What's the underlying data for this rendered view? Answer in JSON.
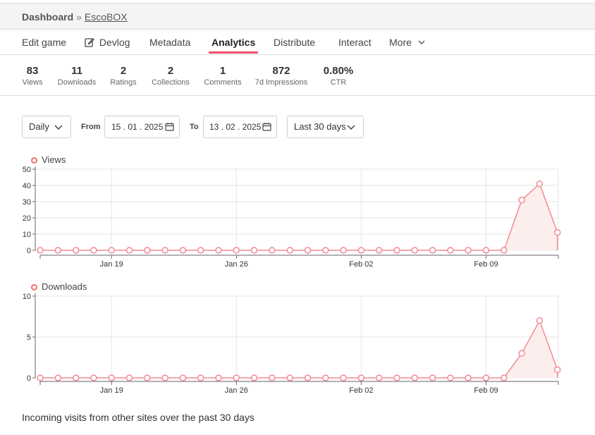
{
  "breadcrumb": {
    "root": "Dashboard",
    "separator": "»",
    "game": "EscoBOX"
  },
  "tabs": [
    {
      "label": "Edit game"
    },
    {
      "label": "Devlog"
    },
    {
      "label": "Metadata"
    },
    {
      "label": "Analytics"
    },
    {
      "label": "Distribute"
    },
    {
      "label": "Interact"
    },
    {
      "label": "More"
    }
  ],
  "active_tab": "Analytics",
  "stats": [
    {
      "value": "83",
      "label": "Views"
    },
    {
      "value": "11",
      "label": "Downloads"
    },
    {
      "value": "2",
      "label": "Ratings"
    },
    {
      "value": "2",
      "label": "Collections"
    },
    {
      "value": "1",
      "label": "Comments"
    },
    {
      "value": "872",
      "label": "7d Impressions"
    },
    {
      "value": "0.80%",
      "label": "CTR"
    }
  ],
  "controls": {
    "interval": "Daily",
    "from_label": "From",
    "from_date": "15 . 01 . 2025",
    "to_label": "To",
    "to_date": "13 . 02 . 2025",
    "range": "Last 30 days"
  },
  "colors": {
    "accent": "#f04e69",
    "series": "#f28b90",
    "fill": "#fdeeee"
  },
  "chart_data": [
    {
      "type": "area",
      "legend": "Views",
      "x_ticks": [
        "Jan 19",
        "Jan 26",
        "Feb 02",
        "Feb 09"
      ],
      "ylim": [
        0,
        50
      ],
      "y_ticks": [
        0,
        10,
        20,
        30,
        40,
        50
      ],
      "x_range": [
        "2025-01-15",
        "2025-02-13"
      ],
      "series": [
        {
          "name": "Views",
          "values": [
            0,
            0,
            0,
            0,
            0,
            0,
            0,
            0,
            0,
            0,
            0,
            0,
            0,
            0,
            0,
            0,
            0,
            0,
            0,
            0,
            0,
            0,
            0,
            0,
            0,
            0,
            0,
            31,
            41,
            11
          ]
        }
      ]
    },
    {
      "type": "area",
      "legend": "Downloads",
      "x_ticks": [
        "Jan 19",
        "Jan 26",
        "Feb 02",
        "Feb 09"
      ],
      "ylim": [
        0,
        10
      ],
      "y_ticks": [
        0,
        5,
        10
      ],
      "x_range": [
        "2025-01-15",
        "2025-02-13"
      ],
      "series": [
        {
          "name": "Downloads",
          "values": [
            0,
            0,
            0,
            0,
            0,
            0,
            0,
            0,
            0,
            0,
            0,
            0,
            0,
            0,
            0,
            0,
            0,
            0,
            0,
            0,
            0,
            0,
            0,
            0,
            0,
            0,
            0,
            3,
            7,
            1
          ]
        }
      ]
    }
  ],
  "footer": {
    "text": "Incoming visits from other sites over the past 30 days"
  }
}
